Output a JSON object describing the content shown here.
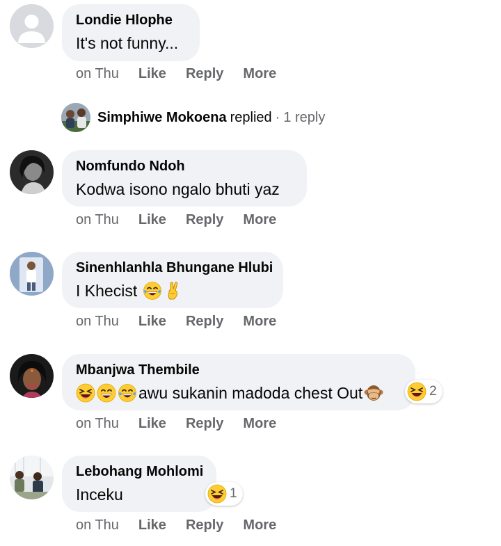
{
  "comments": [
    {
      "author": "Londie Hlophe",
      "text": "It's not funny...",
      "time": "on Thu",
      "like": "Like",
      "reply": "Reply",
      "more": "More"
    },
    {
      "author": "Nomfundo Ndoh",
      "text": "Kodwa isono ngalo bhuti yaz",
      "time": "on Thu",
      "like": "Like",
      "reply": "Reply",
      "more": "More"
    },
    {
      "author": "Sinenhlanhla Bhungane Hlubi",
      "text": "I Khecist",
      "time": "on Thu",
      "like": "Like",
      "reply": "Reply",
      "more": "More"
    },
    {
      "author": "Mbanjwa Thembile",
      "text": "awu sukanin madoda chest Out",
      "time": "on Thu",
      "like": "Like",
      "reply": "Reply",
      "more": "More",
      "reaction_count": "2"
    },
    {
      "author": "Lebohang Mohlomi",
      "text": "Inceku",
      "time": "on Thu",
      "like": "Like",
      "reply": "Reply",
      "more": "More",
      "reaction_count": "1"
    }
  ],
  "reply_thread": {
    "name": "Simphiwe Mokoena",
    "verb": "replied",
    "separator": "·",
    "count": "1 reply"
  },
  "icons": {
    "laugh": "laughing-emoji",
    "tears": "tears-of-joy-emoji",
    "victory": "victory-hand-emoji",
    "see_no_evil": "see-no-evil-monkey-emoji",
    "squint": "squinting-laugh-emoji"
  },
  "colors": {
    "bubble": "#f0f2f5",
    "secondary_text": "#65676b",
    "primary_text": "#050505"
  }
}
